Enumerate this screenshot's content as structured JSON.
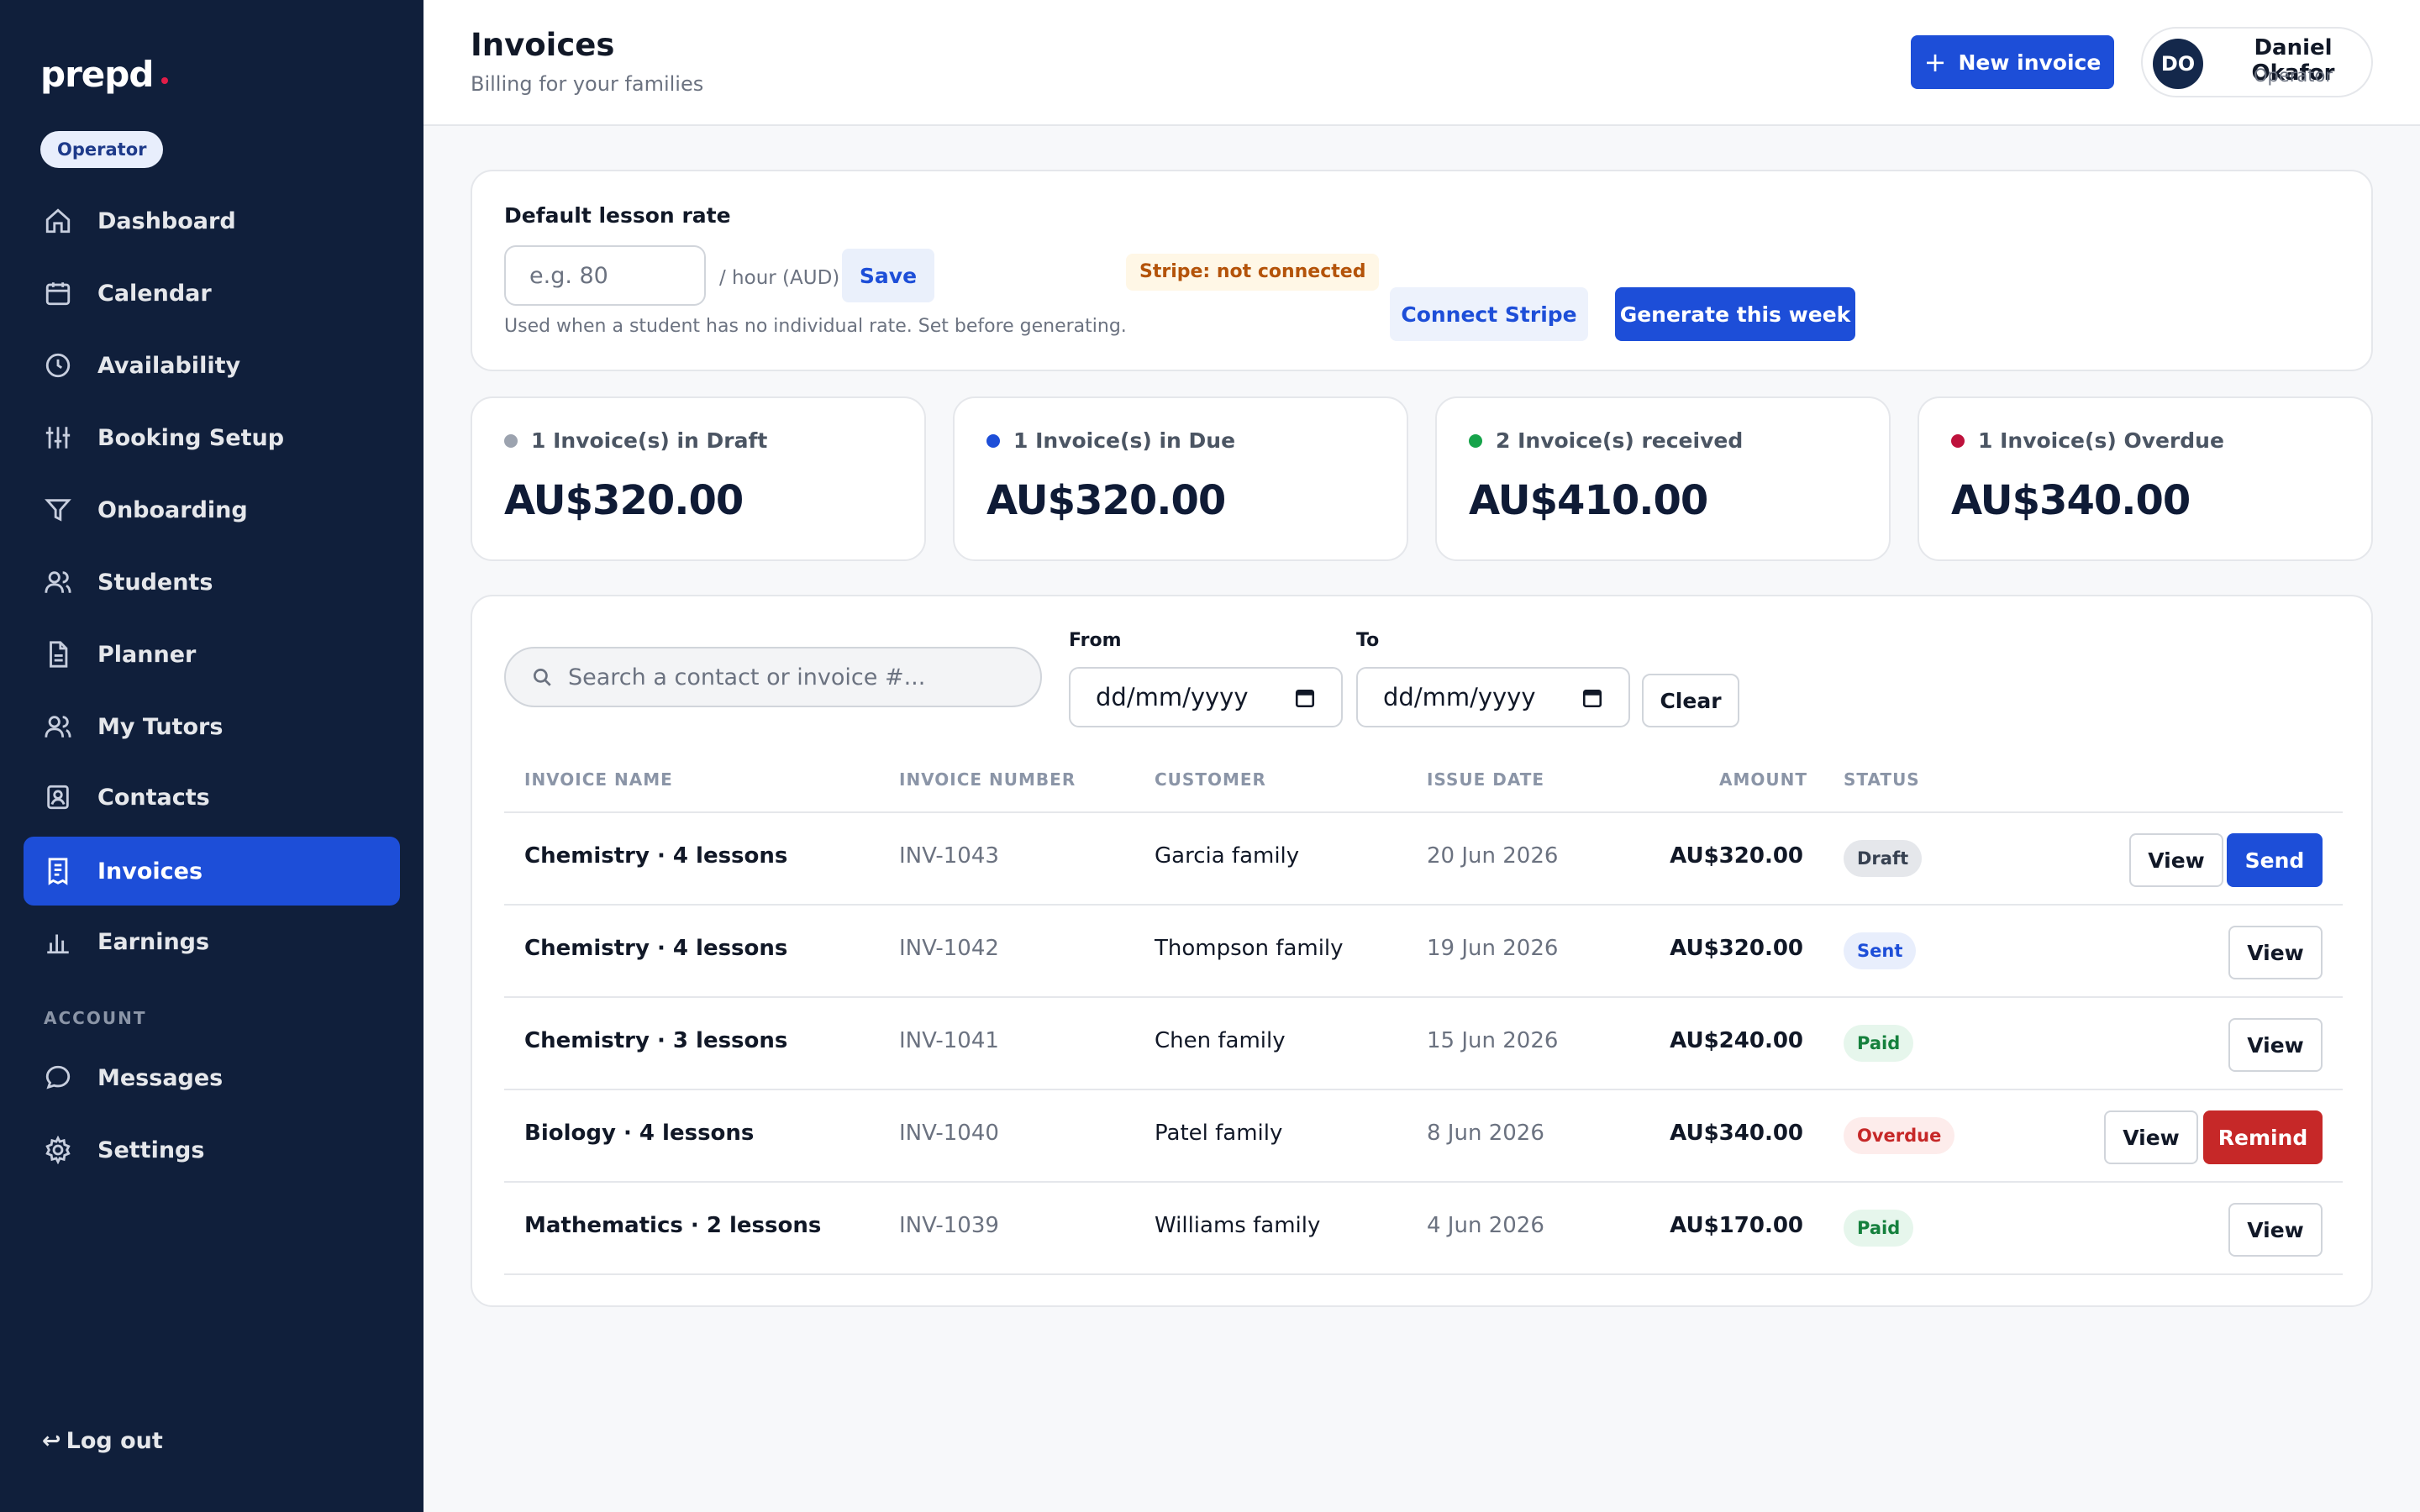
{
  "brand": {
    "name": "prepd",
    "role_badge": "Operator"
  },
  "sidebar": {
    "items": [
      {
        "label": "Dashboard",
        "icon": "home-icon"
      },
      {
        "label": "Calendar",
        "icon": "calendar-icon"
      },
      {
        "label": "Availability",
        "icon": "clock-icon"
      },
      {
        "label": "Booking Setup",
        "icon": "sliders-icon"
      },
      {
        "label": "Onboarding",
        "icon": "filter-icon"
      },
      {
        "label": "Students",
        "icon": "users-icon"
      },
      {
        "label": "Planner",
        "icon": "document-icon"
      },
      {
        "label": "My Tutors",
        "icon": "users-icon"
      },
      {
        "label": "Contacts",
        "icon": "contact-card-icon"
      },
      {
        "label": "Invoices",
        "icon": "receipt-icon",
        "active": true
      },
      {
        "label": "Earnings",
        "icon": "bar-chart-icon"
      }
    ],
    "account_label": "ACCOUNT",
    "account_items": [
      {
        "label": "Messages",
        "icon": "message-icon"
      },
      {
        "label": "Settings",
        "icon": "gear-icon"
      }
    ],
    "logout": "Log out"
  },
  "header": {
    "title": "Invoices",
    "subtitle": "Billing for your families",
    "new_invoice": "New invoice",
    "user": {
      "initials": "DO",
      "name": "Daniel Okafor",
      "role": "Operator"
    }
  },
  "rate": {
    "title": "Default lesson rate",
    "placeholder": "e.g. 80",
    "unit": "/ hour (AUD)",
    "save": "Save",
    "help": "Used when a student has no individual rate. Set before generating.",
    "stripe_status": "Stripe: not connected",
    "connect": "Connect Stripe",
    "generate": "Generate this week"
  },
  "stats": [
    {
      "label": "1 Invoice(s) in Draft",
      "amount": "AU$320.00",
      "dot": "#9ca3af"
    },
    {
      "label": "1 Invoice(s) in Due",
      "amount": "AU$320.00",
      "dot": "#1d4ed8"
    },
    {
      "label": "2 Invoice(s) received",
      "amount": "AU$410.00",
      "dot": "#16a34a"
    },
    {
      "label": "1 Invoice(s) Overdue",
      "amount": "AU$340.00",
      "dot": "#be123c"
    }
  ],
  "filters": {
    "search_placeholder": "Search a contact or invoice #...",
    "from_label": "From",
    "to_label": "To",
    "from_value": "dd/mm/yyyy",
    "to_value": "dd/mm/yyyy",
    "clear": "Clear"
  },
  "table": {
    "columns": [
      "INVOICE NAME",
      "INVOICE NUMBER",
      "CUSTOMER",
      "ISSUE DATE",
      "AMOUNT",
      "STATUS"
    ],
    "rows": [
      {
        "name": "Chemistry · 4 lessons",
        "number": "INV-1043",
        "customer": "Garcia family",
        "date": "20 Jun 2026",
        "amount": "AU$320.00",
        "status": "Draft",
        "actions": [
          "View",
          "Send"
        ]
      },
      {
        "name": "Chemistry · 4 lessons",
        "number": "INV-1042",
        "customer": "Thompson family",
        "date": "19 Jun 2026",
        "amount": "AU$320.00",
        "status": "Sent",
        "actions": [
          "View"
        ]
      },
      {
        "name": "Chemistry · 3 lessons",
        "number": "INV-1041",
        "customer": "Chen family",
        "date": "15 Jun 2026",
        "amount": "AU$240.00",
        "status": "Paid",
        "actions": [
          "View"
        ]
      },
      {
        "name": "Biology · 4 lessons",
        "number": "INV-1040",
        "customer": "Patel family",
        "date": "8 Jun 2026",
        "amount": "AU$340.00",
        "status": "Overdue",
        "actions": [
          "View",
          "Remind"
        ]
      },
      {
        "name": "Mathematics · 2 lessons",
        "number": "INV-1039",
        "customer": "Williams family",
        "date": "4 Jun 2026",
        "amount": "AU$170.00",
        "status": "Paid",
        "actions": [
          "View"
        ]
      }
    ]
  },
  "colors": {
    "sidebar_bg": "#101f3b",
    "accent": "#1d4ed8",
    "danger": "#c62828",
    "status_draft": "#e5e7eb",
    "status_sent": "#e8eefc",
    "status_paid": "#e6f6ec",
    "status_overdue": "#fdeceb"
  }
}
